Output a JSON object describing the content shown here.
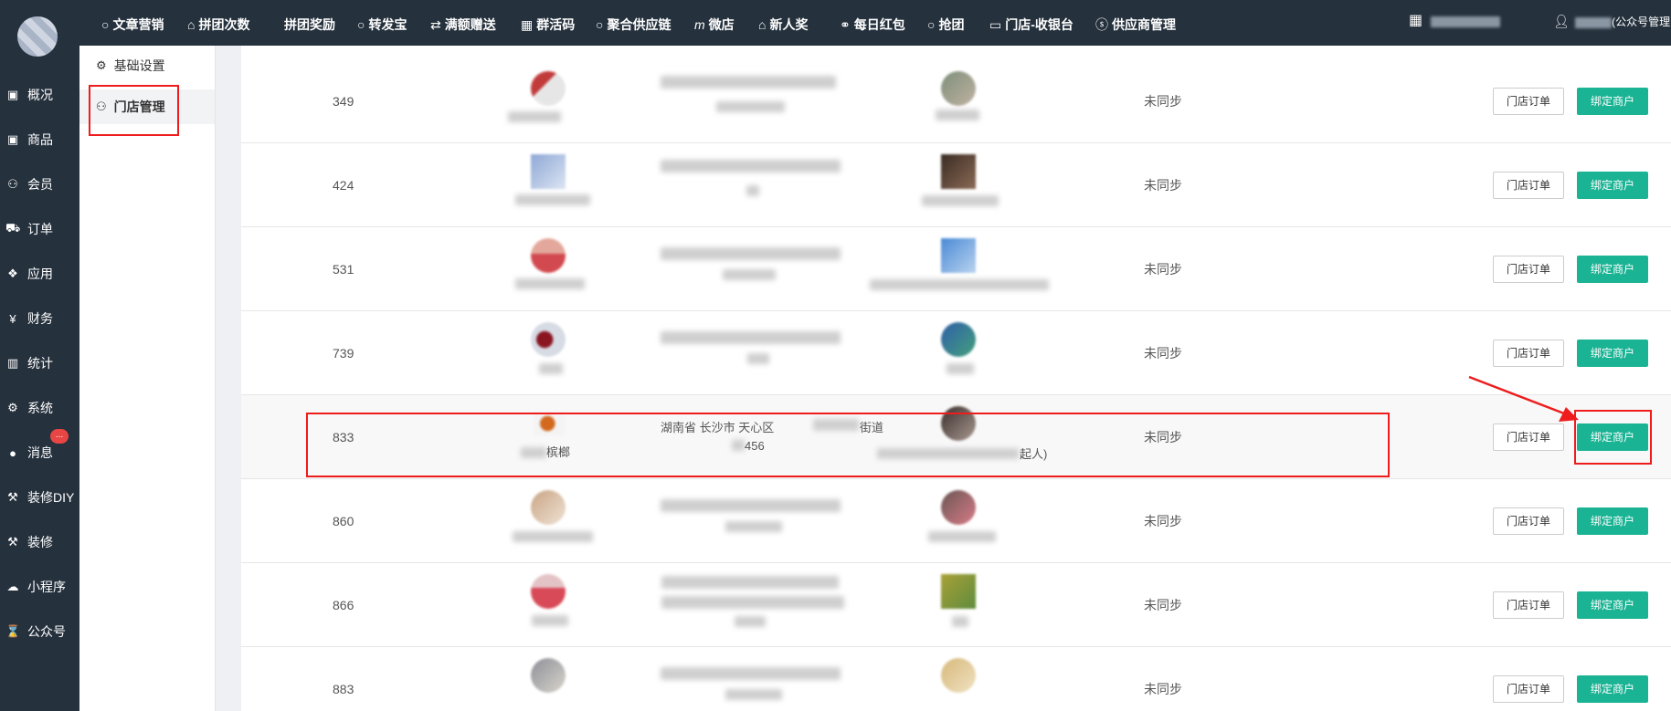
{
  "sidebar": {
    "items": [
      {
        "icon": "dashboard-icon",
        "label": "概况"
      },
      {
        "icon": "goods-icon",
        "label": "商品"
      },
      {
        "icon": "users-icon",
        "label": "会员"
      },
      {
        "icon": "cart-icon",
        "label": "订单"
      },
      {
        "icon": "apps-icon",
        "label": "应用"
      },
      {
        "icon": "yen-icon",
        "label": "财务"
      },
      {
        "icon": "bar-chart-icon",
        "label": "统计"
      },
      {
        "icon": "cogs-icon",
        "label": "系统"
      },
      {
        "icon": "chat-icon",
        "label": "消息"
      },
      {
        "icon": "gavel-icon",
        "label": "装修DIY"
      },
      {
        "icon": "gavel-icon",
        "label": "装修"
      },
      {
        "icon": "wechat-icon",
        "label": "小程序"
      },
      {
        "icon": "hourglass-icon",
        "label": "公众号"
      }
    ],
    "message_badge": "..."
  },
  "topnav": {
    "items": [
      {
        "icon": "circle-icon",
        "label": "文章营销"
      },
      {
        "icon": "cubes-icon",
        "label": "拼团次数"
      },
      {
        "icon": "",
        "label": "拼团奖励"
      },
      {
        "icon": "circle-icon",
        "label": "转发宝"
      },
      {
        "icon": "retweet-icon",
        "label": "满额赠送"
      },
      {
        "icon": "qrcode-icon",
        "label": "群活码"
      },
      {
        "icon": "circle-icon",
        "label": "聚合供应链"
      },
      {
        "icon": "m-icon",
        "label": "微店"
      },
      {
        "icon": "cubes-icon",
        "label": "新人奖"
      },
      {
        "icon": "link-icon",
        "label": "每日红包"
      },
      {
        "icon": "circle-icon",
        "label": "抢团"
      },
      {
        "icon": "cashier-icon",
        "label": "门店-收银台"
      },
      {
        "icon": "skype-icon",
        "label": "供应商管理"
      }
    ],
    "user_suffix": "(公众号管理"
  },
  "subnav": {
    "items": [
      {
        "icon": "gear-icon",
        "label": "基础设置"
      },
      {
        "icon": "users-icon",
        "label": "门店管理"
      }
    ]
  },
  "table": {
    "order_button": "门店订单",
    "bind_button": "绑定商户",
    "rows": [
      {
        "id": "349",
        "status": "未同步"
      },
      {
        "id": "424",
        "status": "未同步"
      },
      {
        "id": "531",
        "status": "未同步"
      },
      {
        "id": "739",
        "status": "未同步"
      },
      {
        "id": "833",
        "status": "未同步",
        "address_line1": "湖南省 长沙市 天心区",
        "address_line1b": "街道",
        "address_line2": "456",
        "store_name_suffix": "槟榔",
        "owner_suffix": "起人)"
      },
      {
        "id": "860",
        "status": "未同步"
      },
      {
        "id": "866",
        "status": "未同步"
      },
      {
        "id": "883",
        "status": "未同步"
      }
    ]
  }
}
